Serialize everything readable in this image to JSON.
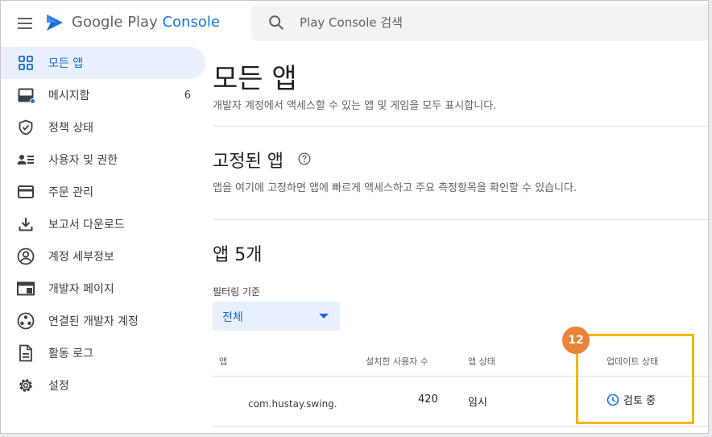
{
  "header": {
    "brand_google": "Google Play ",
    "brand_console": "Console",
    "search_placeholder": "Play Console 검색"
  },
  "sidebar": {
    "items": [
      {
        "label": "모든 앱",
        "icon": "grid-icon",
        "active": true
      },
      {
        "label": "메시지함",
        "icon": "inbox-icon",
        "count": "6"
      },
      {
        "label": "정책 상태",
        "icon": "shield-icon"
      },
      {
        "label": "사용자 및 권한",
        "icon": "people-icon"
      },
      {
        "label": "주문 관리",
        "icon": "credit-card-icon"
      },
      {
        "label": "보고서 다운로드",
        "icon": "download-icon"
      },
      {
        "label": "계정 세부정보",
        "icon": "account-icon"
      },
      {
        "label": "개발자 페이지",
        "icon": "web-page-icon"
      },
      {
        "label": "연결된 개발자 계정",
        "icon": "linked-accounts-icon"
      },
      {
        "label": "활동 로그",
        "icon": "document-icon"
      },
      {
        "label": "설정",
        "icon": "gear-icon"
      }
    ]
  },
  "main": {
    "title": "모든 앱",
    "description": "개발자 계정에서 액세스할 수 있는 앱 및 게임을 모두 표시합니다.",
    "pinned": {
      "title": "고정된 앱",
      "description": "앱을 여기에 고정하면 앱에 빠르게 액세스하고 주요 측정항목을 확인할 수 있습니다."
    },
    "apps": {
      "title": "앱 5개",
      "filter_label": "필터링 기준",
      "filter_value": "전체",
      "columns": [
        "앱",
        "설치한 사용자 수",
        "앱 상태",
        "업데이트 상태"
      ],
      "rows": [
        {
          "app": "com.hustay.swing.",
          "installs": "420",
          "app_status": "임시",
          "update_status": "검토 중"
        }
      ]
    }
  },
  "annotation": {
    "badge": "12",
    "color": "#f5b800",
    "badge_color": "#e8833a"
  },
  "colors": {
    "accent": "#1a73e8",
    "active_bg": "#e8f0fe"
  }
}
